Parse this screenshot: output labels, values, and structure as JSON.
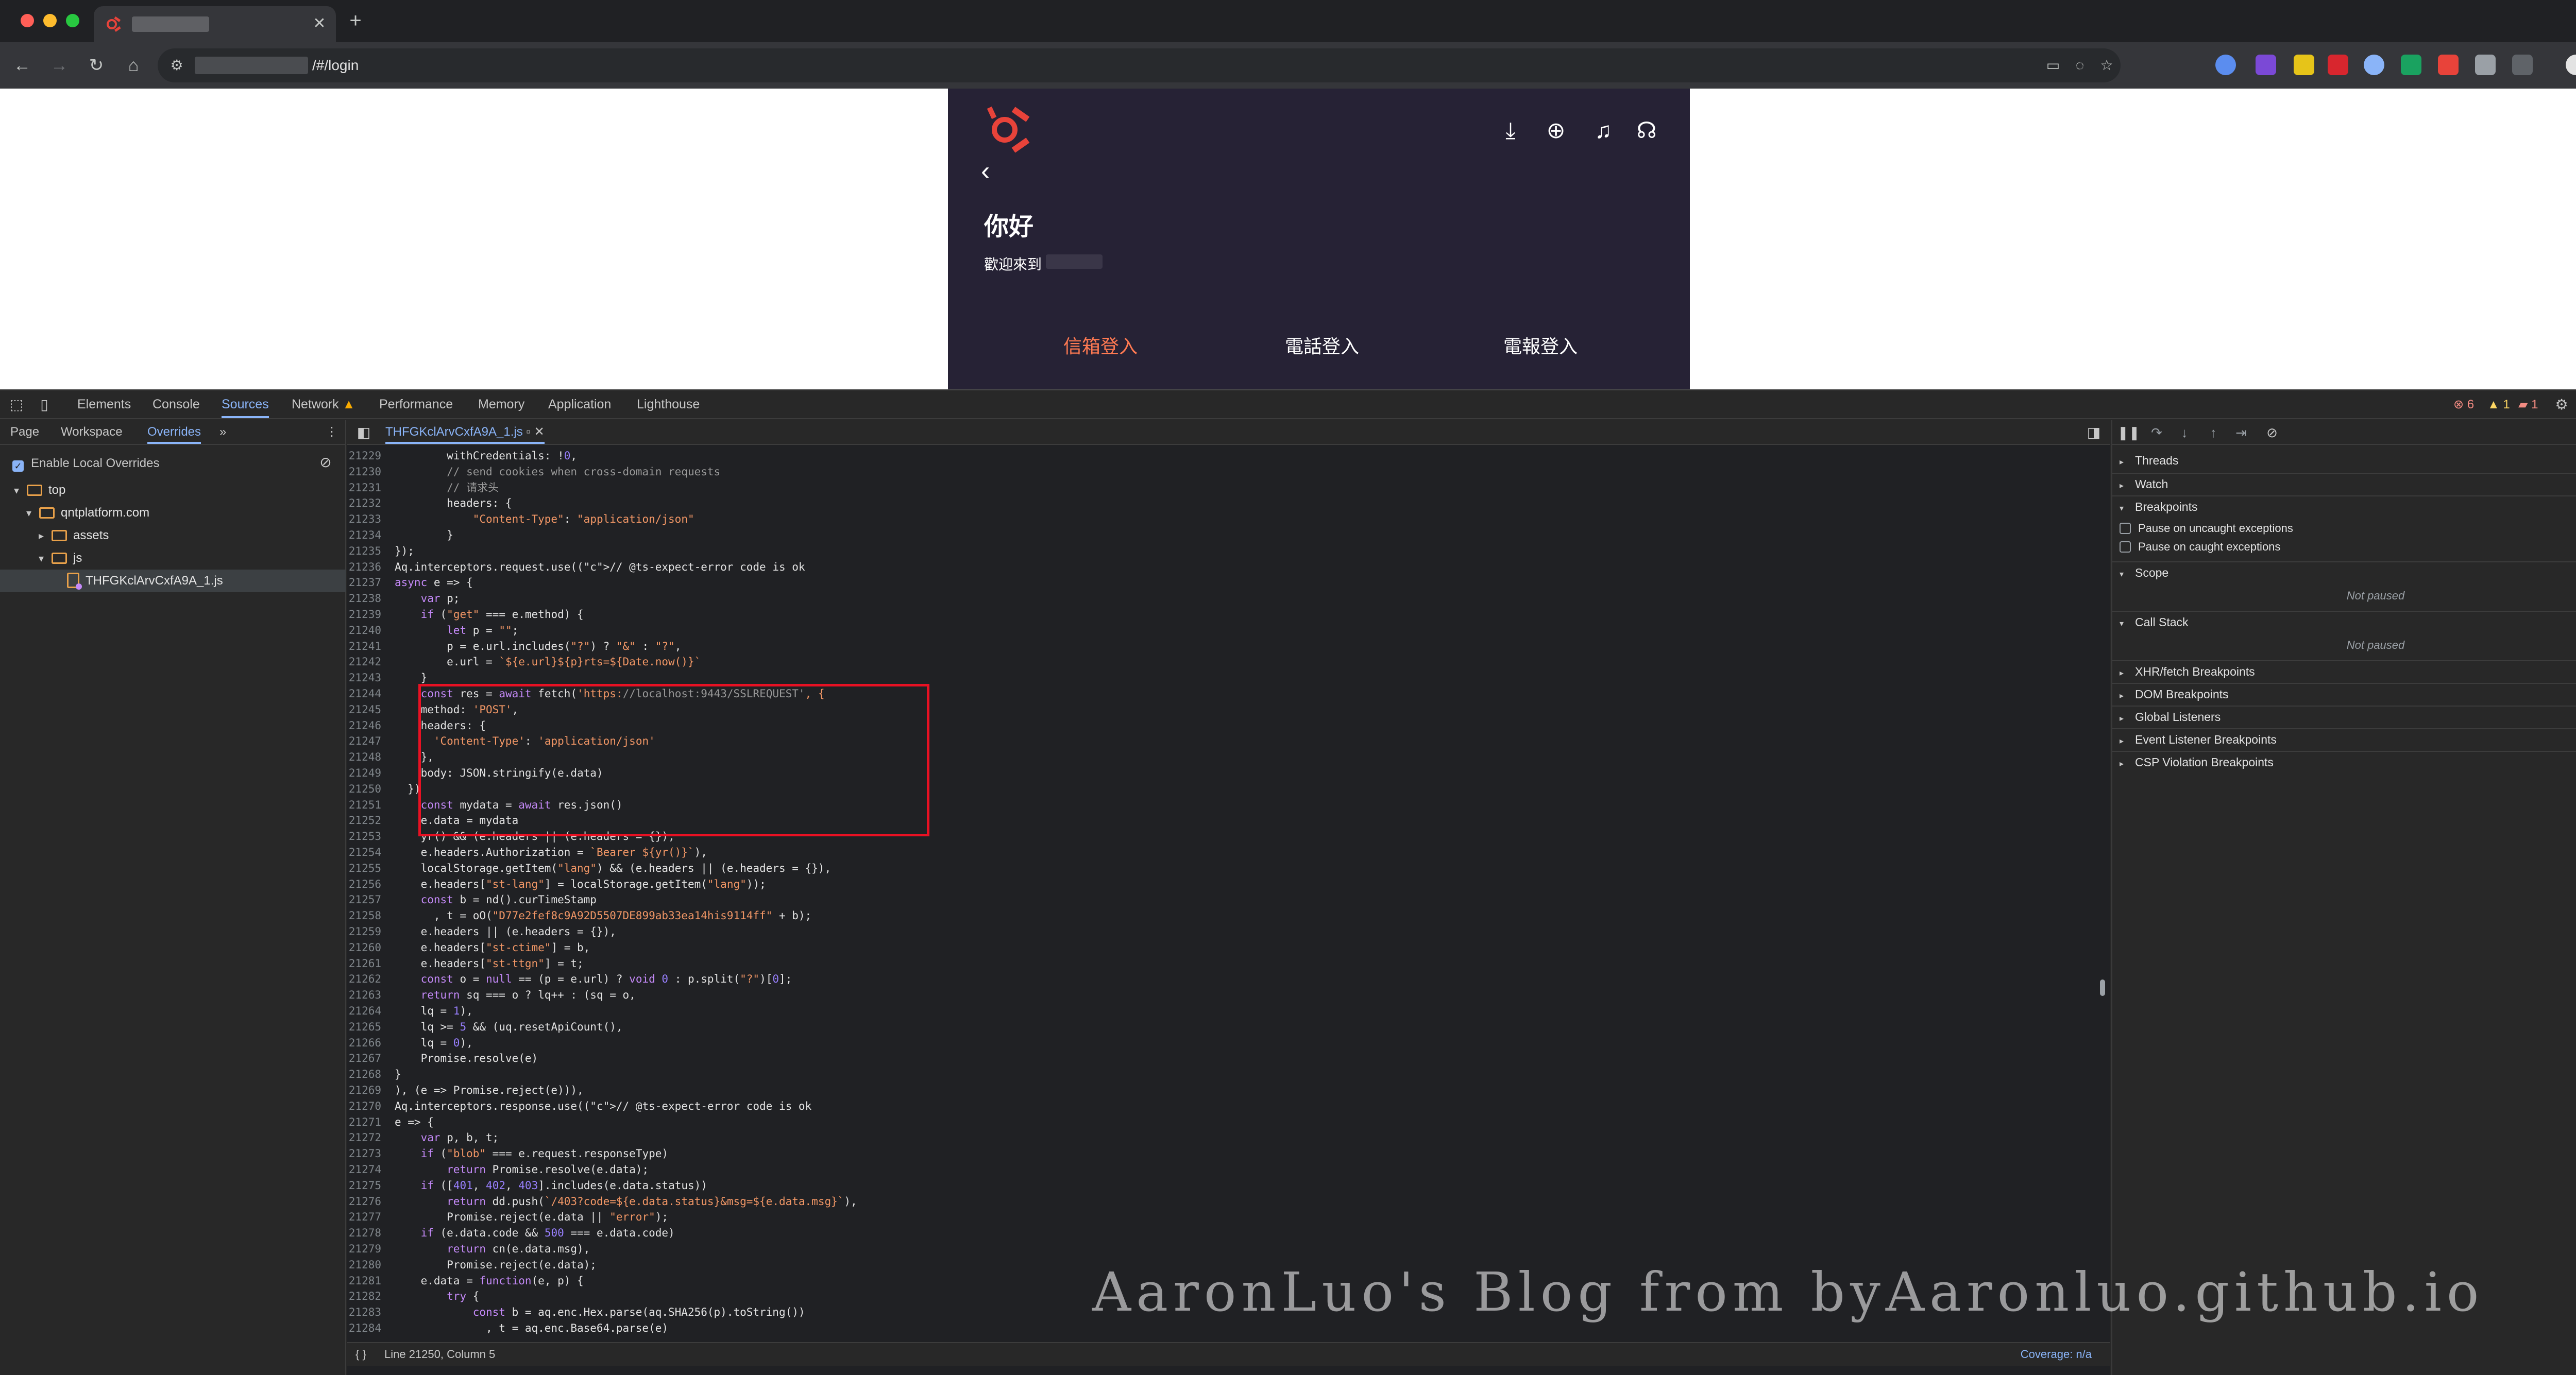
{
  "browser": {
    "url_suffix": "/#/login",
    "traffic": [
      "#ff5f57",
      "#febc2e",
      "#28c840"
    ]
  },
  "app": {
    "hello": "你好",
    "welcome": "歡迎來到",
    "tabs": [
      {
        "label": "信箱登入",
        "active": true
      },
      {
        "label": "電話登入",
        "active": false
      },
      {
        "label": "電報登入",
        "active": false
      }
    ],
    "accent": "#ff7a52"
  },
  "devtools": {
    "tabs": [
      "Elements",
      "Console",
      "Sources",
      "Network",
      "Performance",
      "Memory",
      "Application",
      "Lighthouse"
    ],
    "active_tab": "Sources",
    "errors": "6",
    "warnings": "1",
    "issues": "1",
    "navigator": {
      "tabs": [
        "Page",
        "Workspace",
        "Overrides"
      ],
      "active": "Overrides",
      "enable_local_overrides": "Enable Local Overrides",
      "tree": [
        "top",
        "qntplatform.com",
        "assets",
        "js",
        "THFGKclArvCxfA9A_1.js"
      ]
    },
    "editor": {
      "filename": "THFGKclArvCxfA9A_1.js",
      "status_left": "Line 21250, Column 5",
      "coverage": "Coverage: n/a",
      "lines": [
        {
          "n": "21229",
          "t": "        withCredentials: !0,"
        },
        {
          "n": "21230",
          "t": "        // send cookies when cross-domain requests"
        },
        {
          "n": "21231",
          "t": "        // 请求头"
        },
        {
          "n": "21232",
          "t": "        headers: {"
        },
        {
          "n": "21233",
          "t": "            \"Content-Type\": \"application/json\""
        },
        {
          "n": "21234",
          "t": "        }"
        },
        {
          "n": "21235",
          "t": "});"
        },
        {
          "n": "21236",
          "t": "Aq.interceptors.request.use((// @ts-expect-error code is ok"
        },
        {
          "n": "21237",
          "t": "async e => {"
        },
        {
          "n": "21238",
          "t": "    var p;"
        },
        {
          "n": "21239",
          "t": "    if (\"get\" === e.method) {"
        },
        {
          "n": "21240",
          "t": "        let p = \"\";"
        },
        {
          "n": "21241",
          "t": "        p = e.url.includes(\"?\") ? \"&\" : \"?\","
        },
        {
          "n": "21242",
          "t": "        e.url = `${e.url}${p}rts=${Date.now()}`"
        },
        {
          "n": "21243",
          "t": "    }"
        },
        {
          "n": "21244",
          "t": "    const res = await fetch('https://localhost:9443/SSLREQUEST', {"
        },
        {
          "n": "21245",
          "t": "    method: 'POST',"
        },
        {
          "n": "21246",
          "t": "    headers: {"
        },
        {
          "n": "21247",
          "t": "      'Content-Type': 'application/json'"
        },
        {
          "n": "21248",
          "t": "    },"
        },
        {
          "n": "21249",
          "t": "    body: JSON.stringify(e.data)"
        },
        {
          "n": "21250",
          "t": "  })"
        },
        {
          "n": "21251",
          "t": "    const mydata = await res.json()"
        },
        {
          "n": "21252",
          "t": "    e.data = mydata"
        },
        {
          "n": "21253",
          "t": "    yr() && (e.headers || (e.headers = {}),"
        },
        {
          "n": "21254",
          "t": "    e.headers.Authorization = `Bearer ${yr()}`),"
        },
        {
          "n": "21255",
          "t": "    localStorage.getItem(\"lang\") && (e.headers || (e.headers = {}),"
        },
        {
          "n": "21256",
          "t": "    e.headers[\"st-lang\"] = localStorage.getItem(\"lang\"));"
        },
        {
          "n": "21257",
          "t": "    const b = nd().curTimeStamp"
        },
        {
          "n": "21258",
          "t": "      , t = oO(\"D77e2fef8c9A92D5507DE899ab33ea14his9114ff\" + b);"
        },
        {
          "n": "21259",
          "t": "    e.headers || (e.headers = {}),"
        },
        {
          "n": "21260",
          "t": "    e.headers[\"st-ctime\"] = b,"
        },
        {
          "n": "21261",
          "t": "    e.headers[\"st-ttgn\"] = t;"
        },
        {
          "n": "21262",
          "t": "    const o = null == (p = e.url) ? void 0 : p.split(\"?\")[0];"
        },
        {
          "n": "21263",
          "t": "    return sq === o ? lq++ : (sq = o,"
        },
        {
          "n": "21264",
          "t": "    lq = 1),"
        },
        {
          "n": "21265",
          "t": "    lq >= 5 && (uq.resetApiCount(),"
        },
        {
          "n": "21266",
          "t": "    lq = 0),"
        },
        {
          "n": "21267",
          "t": "    Promise.resolve(e)"
        },
        {
          "n": "21268",
          "t": "}"
        },
        {
          "n": "21269",
          "t": "), (e => Promise.reject(e))),"
        },
        {
          "n": "21270",
          "t": "Aq.interceptors.response.use((// @ts-expect-error code is ok"
        },
        {
          "n": "21271",
          "t": "e => {"
        },
        {
          "n": "21272",
          "t": "    var p, b, t;"
        },
        {
          "n": "21273",
          "t": "    if (\"blob\" === e.request.responseType)"
        },
        {
          "n": "21274",
          "t": "        return Promise.resolve(e.data);"
        },
        {
          "n": "21275",
          "t": "    if ([401, 402, 403].includes(e.data.status))"
        },
        {
          "n": "21276",
          "t": "        return dd.push(`/403?code=${e.data.status}&msg=${e.data.msg}`),"
        },
        {
          "n": "21277",
          "t": "        Promise.reject(e.data || \"error\");"
        },
        {
          "n": "21278",
          "t": "    if (e.data.code && 500 === e.data.code)"
        },
        {
          "n": "21279",
          "t": "        return cn(e.data.msg),"
        },
        {
          "n": "21280",
          "t": "        Promise.reject(e.data);"
        },
        {
          "n": "21281",
          "t": "    e.data = function(e, p) {"
        },
        {
          "n": "21282",
          "t": "        try {"
        },
        {
          "n": "21283",
          "t": "            const b = aq.enc.Hex.parse(aq.SHA256(p).toString())"
        },
        {
          "n": "21284",
          "t": "              , t = aq.enc.Base64.parse(e)"
        }
      ]
    },
    "debugger": {
      "threads": "Threads",
      "watch": "Watch",
      "breakpoints": "Breakpoints",
      "pause_uncaught": "Pause on uncaught exceptions",
      "pause_caught": "Pause on caught exceptions",
      "scope": "Scope",
      "not_paused": "Not paused",
      "call_stack": "Call Stack",
      "xhr": "XHR/fetch Breakpoints",
      "dom": "DOM Breakpoints",
      "global": "Global Listeners",
      "event": "Event Listener Breakpoints",
      "csp": "CSP Violation Breakpoints"
    }
  },
  "watermark": "AaronLuo's Blog from byAaronluo.github.io"
}
